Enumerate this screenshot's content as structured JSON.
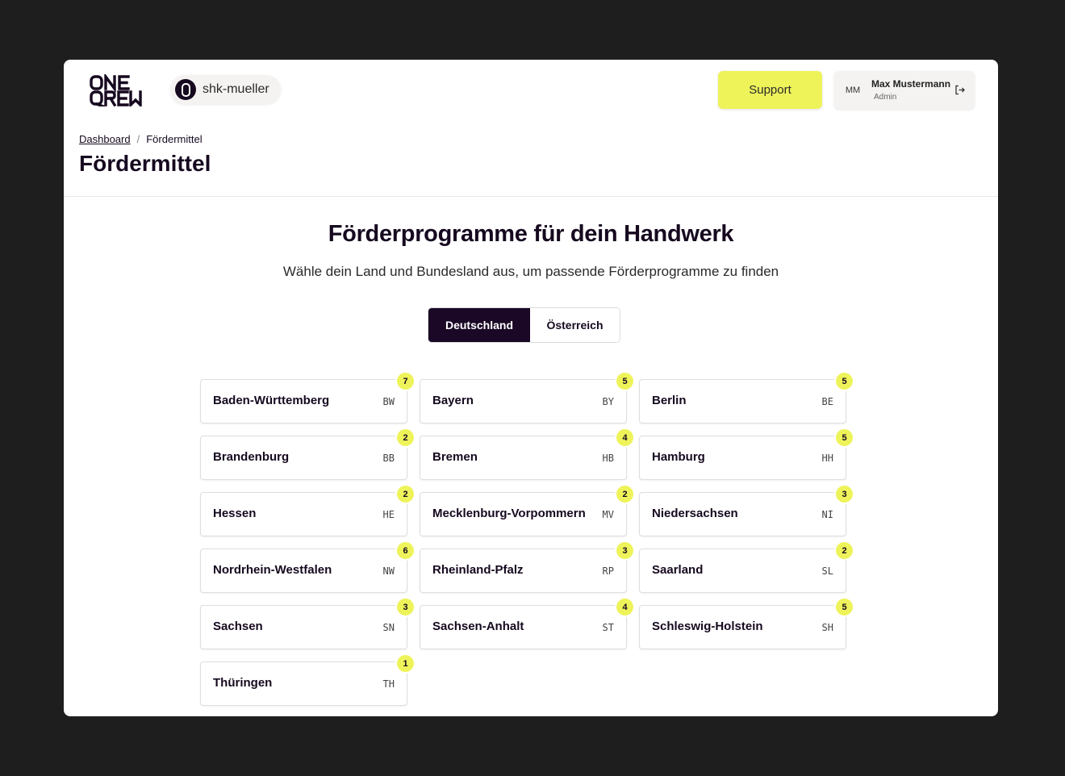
{
  "header": {
    "logo_text": "ONE QREW",
    "workspace": "shk-mueller",
    "support_label": "Support",
    "user": {
      "initials": "MM",
      "name": "Max Mustermann",
      "role": "Admin"
    }
  },
  "breadcrumb": {
    "root": "Dashboard",
    "separator": "/",
    "current": "Fördermittel"
  },
  "page_title": "Fördermittel",
  "main": {
    "heading": "Förderprogramme für dein Handwerk",
    "subheading": "Wähle dein Land und Bundesland aus, um passende Förderprogramme zu finden",
    "countries": [
      {
        "label": "Deutschland",
        "active": true
      },
      {
        "label": "Österreich",
        "active": false
      }
    ]
  },
  "states": [
    {
      "name": "Baden-Württemberg",
      "code": "BW",
      "count": "7"
    },
    {
      "name": "Bayern",
      "code": "BY",
      "count": "5"
    },
    {
      "name": "Berlin",
      "code": "BE",
      "count": "5"
    },
    {
      "name": "Brandenburg",
      "code": "BB",
      "count": "2"
    },
    {
      "name": "Bremen",
      "code": "HB",
      "count": "4"
    },
    {
      "name": "Hamburg",
      "code": "HH",
      "count": "5"
    },
    {
      "name": "Hessen",
      "code": "HE",
      "count": "2"
    },
    {
      "name": "Mecklenburg-Vorpommern",
      "code": "MV",
      "count": "2"
    },
    {
      "name": "Niedersachsen",
      "code": "NI",
      "count": "3"
    },
    {
      "name": "Nordrhein-Westfalen",
      "code": "NW",
      "count": "6"
    },
    {
      "name": "Rheinland-Pfalz",
      "code": "RP",
      "count": "3"
    },
    {
      "name": "Saarland",
      "code": "SL",
      "count": "2"
    },
    {
      "name": "Sachsen",
      "code": "SN",
      "count": "3"
    },
    {
      "name": "Sachsen-Anhalt",
      "code": "ST",
      "count": "4"
    },
    {
      "name": "Schleswig-Holstein",
      "code": "SH",
      "count": "5"
    },
    {
      "name": "Thüringen",
      "code": "TH",
      "count": "1"
    }
  ],
  "colors": {
    "accent": "#eef35a",
    "primary_dark": "#1a0826",
    "background": "#1f1e1e"
  }
}
